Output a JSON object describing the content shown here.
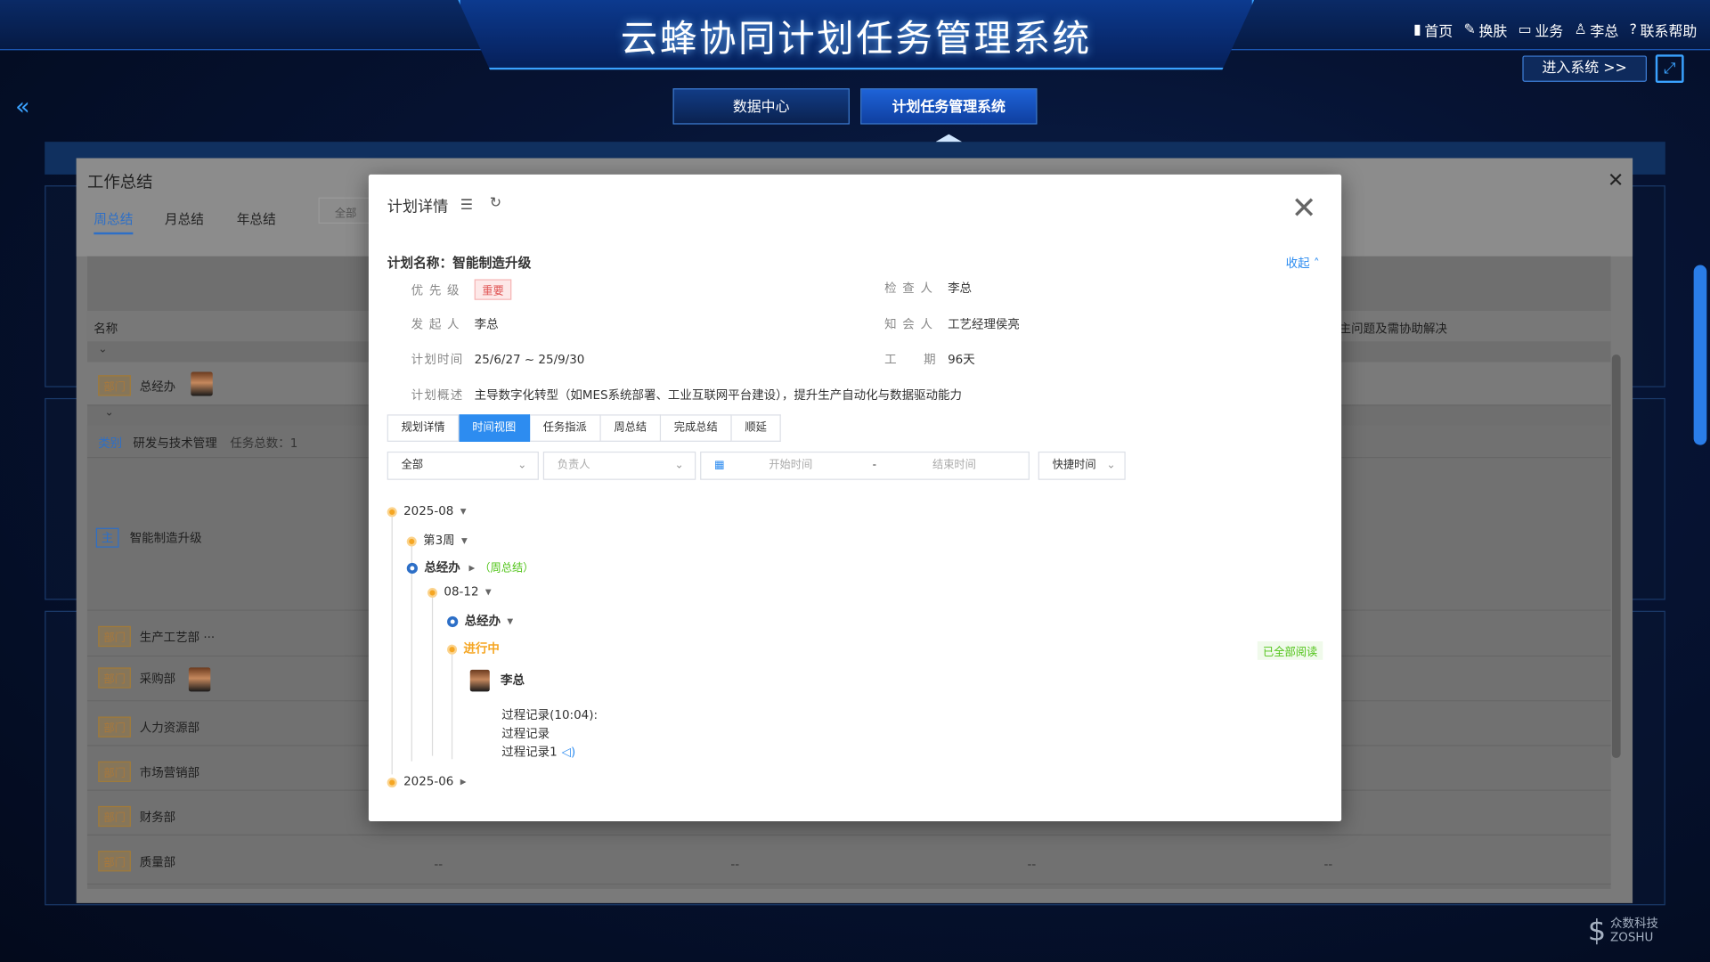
{
  "header": {
    "title": "云蜂协同计划任务管理系统",
    "nav": [
      "首页",
      "换肤",
      "业务",
      "李总",
      "联系帮助"
    ],
    "enter_label": "进入系统 >>",
    "main_tabs": [
      "数据中心",
      "计划任务管理系统"
    ]
  },
  "work_summary": {
    "title": "工作总结",
    "tabs": [
      "周总结",
      "月总结",
      "年总结"
    ],
    "filter_label": "全部",
    "col_name": "名称",
    "col_right": "主问题及需协助解决",
    "rows": [
      {
        "tag": "部门",
        "name": "总经办"
      },
      {
        "tag": "类别",
        "name": "研发与技术管理",
        "extra": "任务总数：1"
      },
      {
        "tag": "主",
        "name": "智能制造升级"
      },
      {
        "tag": "部门",
        "name": "生产工艺部 ···"
      },
      {
        "tag": "部门",
        "name": "采购部"
      },
      {
        "tag": "部门",
        "name": "人力资源部"
      },
      {
        "tag": "部门",
        "name": "市场营销部"
      },
      {
        "tag": "部门",
        "name": "财务部"
      },
      {
        "tag": "部门",
        "name": "质量部"
      }
    ],
    "dash": "--"
  },
  "modal": {
    "title": "计划详情",
    "plan_name_label": "计划名称：",
    "plan_name": "智能制造升级",
    "collapse_label": "收起",
    "fields": {
      "priority_label": "优 先 级",
      "priority": "重要",
      "checker_label": "检 查 人",
      "checker": "李总",
      "initiator_label": "发 起 人",
      "initiator": "李总",
      "notify_label": "知 会 人",
      "notify": "工艺经理侯亮",
      "time_label": "计划时间",
      "time": "25/6/27 ~ 25/9/30",
      "duration_label": "工　　期",
      "duration": "96天",
      "overview_label": "计划概述",
      "overview": "主导数字化转型（如MES系统部署、工业互联网平台建设），提升生产自动化与数据驱动能力"
    },
    "tabs": [
      "规划详情",
      "时间视图",
      "任务指派",
      "周总结",
      "完成总结",
      "顺延"
    ],
    "active_tab": "时间视图",
    "filters": {
      "scope": "全部",
      "owner_placeholder": "负责人",
      "start_placeholder": "开始时间",
      "range_sep": "-",
      "end_placeholder": "结束时间",
      "quick": "快捷时间"
    },
    "timeline": {
      "month1": "2025-08",
      "week": "第3周",
      "dept1": "总经办",
      "dept1_tag": "（周总结）",
      "date": "08-12",
      "dept2": "总经办",
      "status": "进行中",
      "read_badge": "已全部阅读",
      "user": "李总",
      "log1": "过程记录(10:04):",
      "log2": "过程记录",
      "log3": "过程记录1",
      "month2": "2025-06"
    }
  },
  "logo": {
    "line1": "众数科技",
    "line2": "ZOSHU"
  }
}
